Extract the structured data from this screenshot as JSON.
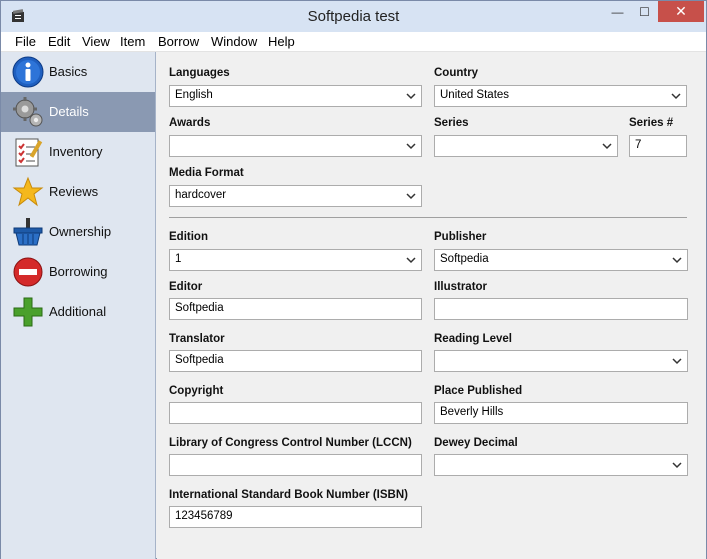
{
  "window": {
    "title": "Softpedia test",
    "close_glyph": "✕",
    "minimize_glyph": "—",
    "maximize_glyph": "☐"
  },
  "menu": [
    "File",
    "Edit",
    "View",
    "Item",
    "Borrow",
    "Window",
    "Help"
  ],
  "sidebar": {
    "items": [
      {
        "label": "Basics",
        "icon": "info-icon",
        "selected": false
      },
      {
        "label": "Details",
        "icon": "gears-icon",
        "selected": true
      },
      {
        "label": "Inventory",
        "icon": "checklist-icon",
        "selected": false
      },
      {
        "label": "Reviews",
        "icon": "star-icon",
        "selected": false
      },
      {
        "label": "Ownership",
        "icon": "basket-icon",
        "selected": false
      },
      {
        "label": "Borrowing",
        "icon": "no-entry-icon",
        "selected": false
      },
      {
        "label": "Additional",
        "icon": "plus-icon",
        "selected": false
      }
    ]
  },
  "form": {
    "languages": {
      "label": "Languages",
      "value": "English"
    },
    "country": {
      "label": "Country",
      "value": "United States"
    },
    "awards": {
      "label": "Awards",
      "value": ""
    },
    "series": {
      "label": "Series",
      "value": ""
    },
    "series_num": {
      "label": "Series #",
      "value": "7"
    },
    "media_format": {
      "label": "Media Format",
      "value": "hardcover"
    },
    "edition": {
      "label": "Edition",
      "value": "1"
    },
    "publisher": {
      "label": "Publisher",
      "value": "Softpedia"
    },
    "editor": {
      "label": "Editor",
      "value": "Softpedia"
    },
    "illustrator": {
      "label": "Illustrator",
      "value": ""
    },
    "translator": {
      "label": "Translator",
      "value": "Softpedia"
    },
    "reading_level": {
      "label": "Reading Level",
      "value": ""
    },
    "copyright": {
      "label": "Copyright",
      "value": ""
    },
    "place_published": {
      "label": "Place Published",
      "value": "Beverly Hills"
    },
    "lccn": {
      "label": "Library of Congress Control Number (LCCN)",
      "value": ""
    },
    "dewey": {
      "label": "Dewey Decimal",
      "value": ""
    },
    "isbn": {
      "label": "International Standard Book Number (ISBN)",
      "value": "123456789"
    }
  },
  "colors": {
    "selected_nav": "#8a99b2",
    "titlebar": "#d7e3f3",
    "close_button": "#c7504a"
  }
}
